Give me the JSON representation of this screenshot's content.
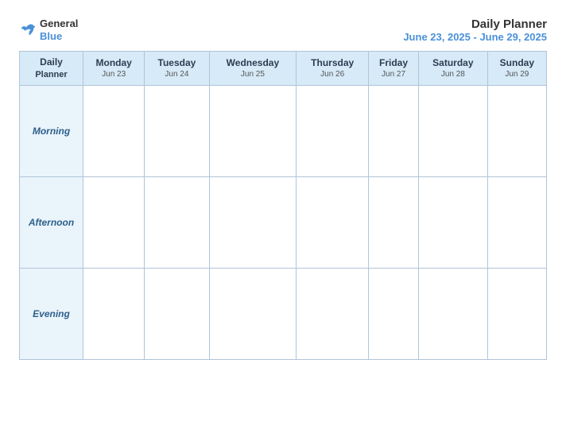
{
  "header": {
    "logo": {
      "name_part1": "General",
      "name_part2": "Blue"
    },
    "title": "Daily Planner",
    "date_range": "June 23, 2025 - June 29, 2025"
  },
  "table": {
    "header_label_line1": "Daily",
    "header_label_line2": "Planner",
    "columns": [
      {
        "day": "Monday",
        "date": "Jun 23"
      },
      {
        "day": "Tuesday",
        "date": "Jun 24"
      },
      {
        "day": "Wednesday",
        "date": "Jun 25"
      },
      {
        "day": "Thursday",
        "date": "Jun 26"
      },
      {
        "day": "Friday",
        "date": "Jun 27"
      },
      {
        "day": "Saturday",
        "date": "Jun 28"
      },
      {
        "day": "Sunday",
        "date": "Jun 29"
      }
    ],
    "rows": [
      {
        "label": "Morning"
      },
      {
        "label": "Afternoon"
      },
      {
        "label": "Evening"
      }
    ]
  }
}
